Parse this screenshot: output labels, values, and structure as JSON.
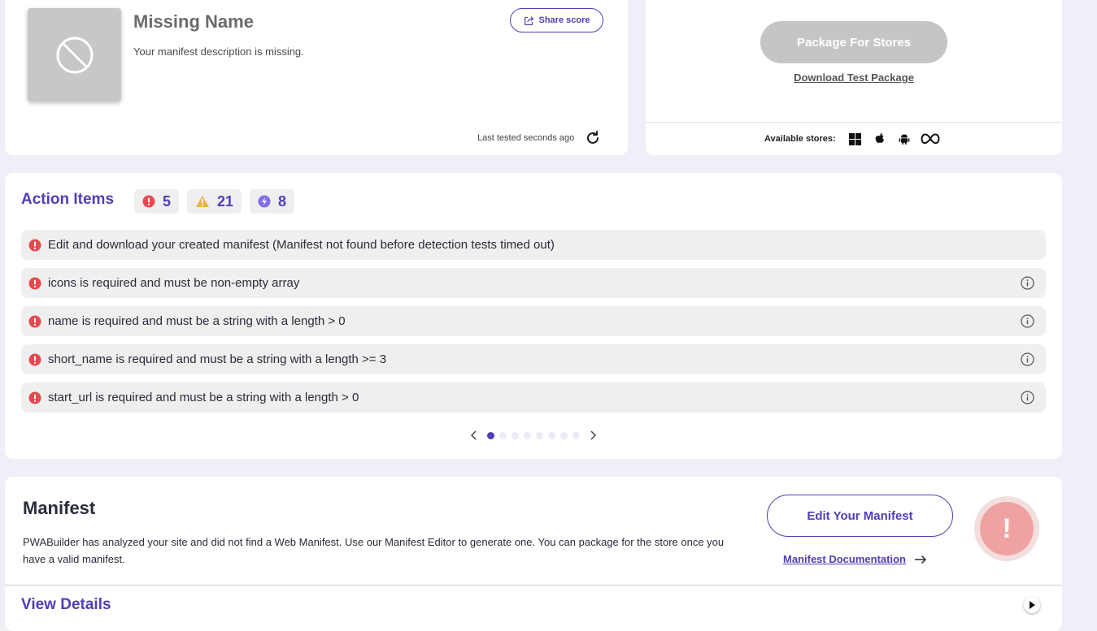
{
  "app": {
    "name": "Missing Name",
    "description": "Your manifest description is missing.",
    "share_label": "Share score",
    "last_tested": "Last tested seconds ago"
  },
  "package": {
    "button_label": "Package For Stores",
    "download_label": "Download Test Package",
    "stores_label": "Available stores:",
    "stores": [
      "windows-icon",
      "apple-icon",
      "android-icon",
      "meta-icon"
    ]
  },
  "action_items": {
    "title": "Action Items",
    "counts": {
      "errors": "5",
      "warnings": "21",
      "suggestions": "8"
    },
    "items": [
      {
        "text": "Edit and download your created manifest (Manifest not found before detection tests timed out)",
        "has_info": false
      },
      {
        "text": "icons is required and must be non-empty array",
        "has_info": true
      },
      {
        "text": "name is required and must be a string with a length > 0",
        "has_info": true
      },
      {
        "text": "short_name is required and must be a string with a length >= 3",
        "has_info": true
      },
      {
        "text": "start_url is required and must be a string with a length > 0",
        "has_info": true
      }
    ],
    "pages": 8,
    "current_page": 1
  },
  "manifest": {
    "title": "Manifest",
    "description": "PWABuilder has analyzed your site and did not find a Web Manifest. Use our Manifest Editor to generate one. You can package for the store once you have a valid manifest.",
    "edit_label": "Edit Your Manifest",
    "docs_label": "Manifest Documentation",
    "status_symbol": "!",
    "view_details": "View Details"
  },
  "colors": {
    "accent": "#4f3fb6",
    "error": "#e8484f",
    "warning": "#e9b343",
    "suggestion": "#7f6ee8",
    "background": "#efeff8"
  }
}
